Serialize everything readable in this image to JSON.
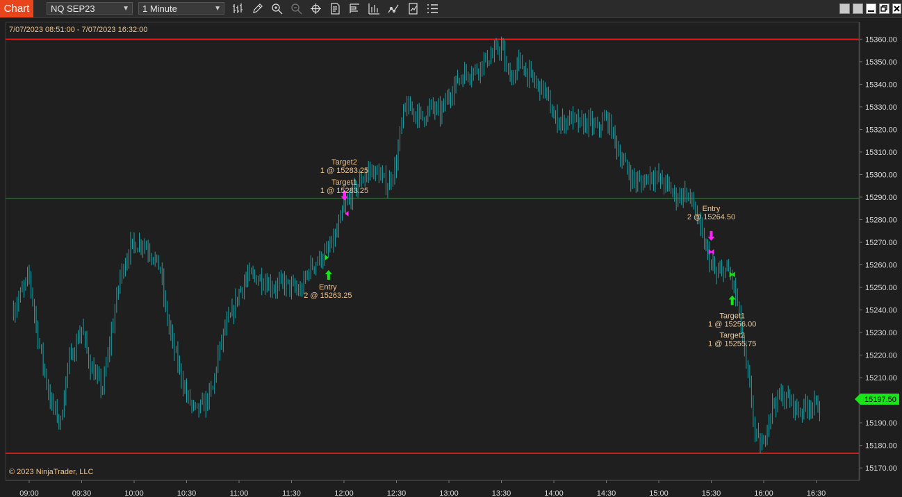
{
  "toolbar": {
    "tab_label": "Chart",
    "instrument": "NQ SEP23",
    "interval": "1 Minute",
    "tools": [
      "bar-style-icon",
      "pencil-icon",
      "zoom-in-icon",
      "zoom-out-icon",
      "crosshair-icon",
      "data-box-icon",
      "properties-icon",
      "bar-chart-icon",
      "indicators-icon",
      "strategies-icon",
      "list-icon"
    ]
  },
  "chart": {
    "range_label": "7/07/2023 08:51:00 - 7/07/2023 16:32:00",
    "copyright": "© 2023 NinjaTrader, LLC",
    "current_price_label": "15197.50",
    "colors": {
      "bars": "#1aa3a8",
      "level_red": "#ff1f1f",
      "level_green": "#0f7a1f",
      "buy": "#19e619",
      "sell": "#ff22ff",
      "annotation": "#f2c48d",
      "price_tag": "#19e619"
    }
  },
  "chart_data": {
    "type": "ohlc",
    "y_axis": {
      "ticks": [
        "15360.00",
        "15350.00",
        "15340.00",
        "15330.00",
        "15320.00",
        "15310.00",
        "15300.00",
        "15290.00",
        "15280.00",
        "15270.00",
        "15260.00",
        "15250.00",
        "15240.00",
        "15230.00",
        "15220.00",
        "15210.00",
        "15200.00",
        "15190.00",
        "15180.00",
        "15170.00"
      ],
      "range": [
        15164.5,
        15367.5
      ]
    },
    "x_axis": {
      "ticks": [
        "09:00",
        "09:30",
        "10:00",
        "10:30",
        "11:00",
        "11:30",
        "12:00",
        "12:30",
        "13:00",
        "13:30",
        "14:00",
        "14:30",
        "15:00",
        "15:30",
        "16:00",
        "16:30"
      ],
      "range": [
        "08:51",
        "16:32"
      ]
    },
    "horizontal_lines": [
      {
        "price": 15360.0,
        "color": "#ff1f1f"
      },
      {
        "price": 15289.5,
        "color": "#0f7a1f"
      },
      {
        "price": 15176.5,
        "color": "#ff1f1f"
      }
    ],
    "close_path": [
      [
        "08:51",
        15240
      ],
      [
        "09:00",
        15255
      ],
      [
        "09:05",
        15228
      ],
      [
        "09:12",
        15200
      ],
      [
        "09:18",
        15190
      ],
      [
        "09:22",
        15215
      ],
      [
        "09:30",
        15232
      ],
      [
        "09:35",
        15215
      ],
      [
        "09:42",
        15205
      ],
      [
        "09:48",
        15235
      ],
      [
        "09:52",
        15255
      ],
      [
        "09:58",
        15268
      ],
      [
        "10:05",
        15270
      ],
      [
        "10:10",
        15265
      ],
      [
        "10:15",
        15258
      ],
      [
        "10:18",
        15240
      ],
      [
        "10:22",
        15225
      ],
      [
        "10:30",
        15202
      ],
      [
        "10:35",
        15195
      ],
      [
        "10:40",
        15198
      ],
      [
        "10:45",
        15205
      ],
      [
        "10:48",
        15220
      ],
      [
        "10:52",
        15232
      ],
      [
        "10:56",
        15238
      ],
      [
        "11:00",
        15248
      ],
      [
        "11:05",
        15255
      ],
      [
        "11:12",
        15254
      ],
      [
        "11:20",
        15250
      ],
      [
        "11:25",
        15252
      ],
      [
        "11:30",
        15250
      ],
      [
        "11:35",
        15248
      ],
      [
        "11:40",
        15258
      ],
      [
        "11:45",
        15262
      ],
      [
        "11:50",
        15265
      ],
      [
        "11:55",
        15272
      ],
      [
        "12:00",
        15285
      ],
      [
        "12:05",
        15292
      ],
      [
        "12:10",
        15298
      ],
      [
        "12:15",
        15302
      ],
      [
        "12:20",
        15300
      ],
      [
        "12:25",
        15295
      ],
      [
        "12:30",
        15305
      ],
      [
        "12:32",
        15318
      ],
      [
        "12:35",
        15330
      ],
      [
        "12:40",
        15328
      ],
      [
        "12:45",
        15325
      ],
      [
        "12:50",
        15330
      ],
      [
        "12:55",
        15327
      ],
      [
        "13:00",
        15335
      ],
      [
        "13:05",
        15342
      ],
      [
        "13:10",
        15345
      ],
      [
        "13:15",
        15346
      ],
      [
        "13:20",
        15350
      ],
      [
        "13:25",
        15353
      ],
      [
        "13:30",
        15357
      ],
      [
        "13:33",
        15346
      ],
      [
        "13:37",
        15343
      ],
      [
        "13:40",
        15350
      ],
      [
        "13:45",
        15345
      ],
      [
        "13:50",
        15340
      ],
      [
        "13:55",
        15337
      ],
      [
        "14:00",
        15325
      ],
      [
        "14:05",
        15323
      ],
      [
        "14:10",
        15325
      ],
      [
        "14:15",
        15322
      ],
      [
        "14:20",
        15323
      ],
      [
        "14:25",
        15320
      ],
      [
        "14:30",
        15325
      ],
      [
        "14:33",
        15320
      ],
      [
        "14:37",
        15310
      ],
      [
        "14:40",
        15305
      ],
      [
        "14:45",
        15298
      ],
      [
        "14:50",
        15296
      ],
      [
        "14:55",
        15300
      ],
      [
        "15:00",
        15298
      ],
      [
        "15:05",
        15295
      ],
      [
        "15:10",
        15290
      ],
      [
        "15:15",
        15292
      ],
      [
        "15:20",
        15287
      ],
      [
        "15:22",
        15280
      ],
      [
        "15:25",
        15272
      ],
      [
        "15:30",
        15260
      ],
      [
        "15:33",
        15255
      ],
      [
        "15:37",
        15258
      ],
      [
        "15:40",
        15257
      ],
      [
        "15:43",
        15250
      ],
      [
        "15:46",
        15238
      ],
      [
        "15:50",
        15215
      ],
      [
        "15:53",
        15200
      ],
      [
        "15:55",
        15185
      ],
      [
        "15:58",
        15180
      ],
      [
        "16:00",
        15180
      ],
      [
        "16:02",
        15190
      ],
      [
        "16:05",
        15198
      ],
      [
        "16:10",
        15202
      ],
      [
        "16:15",
        15200
      ],
      [
        "16:20",
        15195
      ],
      [
        "16:25",
        15198
      ],
      [
        "16:32",
        15197.5
      ]
    ],
    "executions": [
      {
        "label": "Entry",
        "detail": "2 @ 15263.25",
        "time": "11:50",
        "price": 15263.25,
        "side": "buy"
      },
      {
        "label": "Target1",
        "detail": "1 @ 15283.25",
        "time": "12:01",
        "price": 15283.25,
        "side": "sell"
      },
      {
        "label": "Target2",
        "detail": "1 @ 15283.25",
        "time": "12:01",
        "price": 15283.25,
        "side": "sell"
      },
      {
        "label": "Entry",
        "detail": "2 @ 15264.50",
        "time": "15:30",
        "price": 15264.5,
        "side": "sell"
      },
      {
        "label": "Target1",
        "detail": "1 @ 15256.00",
        "time": "15:42",
        "price": 15256.0,
        "side": "buy"
      },
      {
        "label": "Target2",
        "detail": "1 @ 15255.75",
        "time": "15:42",
        "price": 15255.75,
        "side": "buy"
      }
    ],
    "current_price": 15197.5
  }
}
